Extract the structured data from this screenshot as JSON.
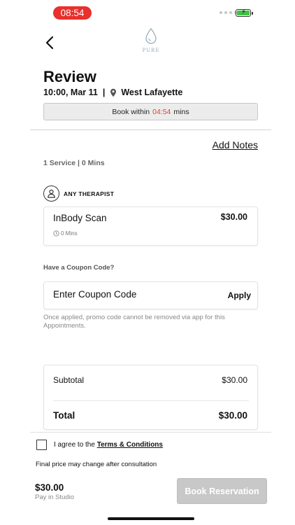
{
  "status_bar": {
    "time": "08:54",
    "colors": {
      "time_pill": "#e8302c",
      "battery_fill": "#3fc544"
    }
  },
  "header": {
    "back_icon": "chevron-left-icon",
    "logo_text": "PURE"
  },
  "page": {
    "title": "Review",
    "date_time": "10:00, Mar 11",
    "separator": "|",
    "location": "West Lafayette",
    "location_icon": "map-pin-icon"
  },
  "timer": {
    "prefix": "Book within",
    "countdown": "04:54",
    "suffix": "mins",
    "countdown_color": "#e0403a"
  },
  "notes": {
    "add_notes_label": "Add Notes"
  },
  "summary": {
    "text": "1 Service | 0 Mins"
  },
  "therapist": {
    "label": "ANY THERAPIST",
    "icon": "user-icon"
  },
  "service": {
    "name": "InBody Scan",
    "price": "$30.00",
    "duration": "0 Mins",
    "duration_icon": "clock-icon"
  },
  "coupon": {
    "question": "Have a Coupon Code?",
    "placeholder": "Enter Coupon Code",
    "apply_label": "Apply",
    "note": "Once applied, promo code cannot be removed via app for this Appointments."
  },
  "totals": {
    "subtotal_label": "Subtotal",
    "subtotal_value": "$30.00",
    "total_label": "Total",
    "total_value": "$30.00"
  },
  "agreement": {
    "text": "I agree to the",
    "link": "Terms & Conditions",
    "checked": false
  },
  "final_note": "Final price may change after consultation",
  "footer": {
    "price": "$30.00",
    "pay_note": "Pay in Studio",
    "book_label": "Book Reservation"
  }
}
